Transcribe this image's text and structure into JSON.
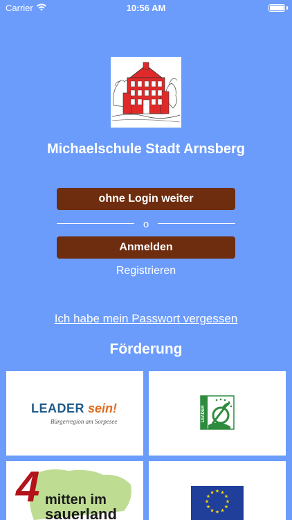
{
  "status_bar": {
    "carrier": "Carrier",
    "time": "10:56 AM",
    "wifi_icon": "wifi-icon",
    "battery_icon": "battery-icon"
  },
  "school": {
    "name": "Michaelschule Stadt Arnsberg",
    "logo_icon": "school-building-logo"
  },
  "actions": {
    "guest_label": "ohne Login weiter",
    "divider_text": "o",
    "login_label": "Anmelden",
    "register_label": "Registrieren",
    "forgot_password_label": "Ich habe mein Passwort vergessen"
  },
  "funding": {
    "title": "Förderung",
    "sponsors": [
      {
        "brand_main": "LEADER",
        "brand_accent": "sein!",
        "tagline": "Bürgerregion am Sorpesee",
        "colors": {
          "main": "#1f5a8a",
          "accent": "#e06a1c"
        }
      },
      {
        "logo": "leader-eu-logo",
        "vertical_text": "LEADER",
        "colors": {
          "main": "#2e8b3e"
        }
      },
      {
        "big_numeral": "4",
        "text_line1": "mitten im",
        "text_line2": "sauerland",
        "colors": {
          "numeral": "#b3121b",
          "map": "#8bbf3a"
        }
      },
      {
        "logo": "eu-flag-logo",
        "colors": {
          "main": "#1f3f9a",
          "stars": "#ffdd00"
        }
      }
    ]
  },
  "colors": {
    "background": "#6b9cfb",
    "button": "#6f2d0f",
    "text": "#ffffff"
  }
}
